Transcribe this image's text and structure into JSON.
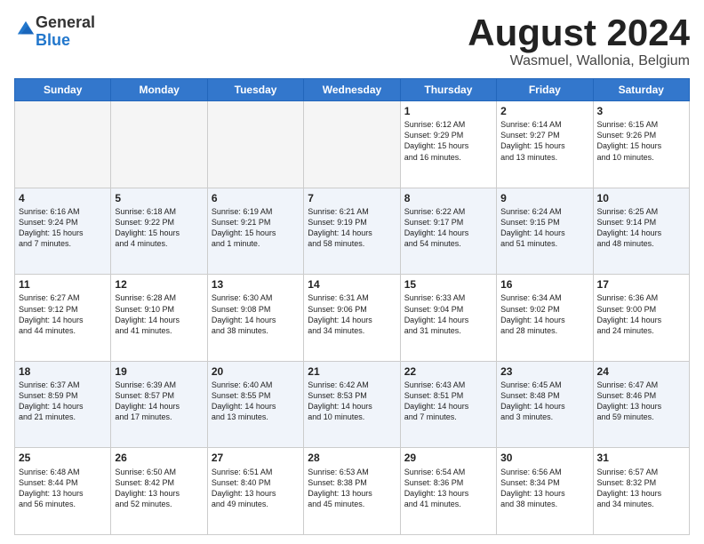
{
  "header": {
    "logo_general": "General",
    "logo_blue": "Blue",
    "title": "August 2024",
    "location": "Wasmuel, Wallonia, Belgium"
  },
  "days_of_week": [
    "Sunday",
    "Monday",
    "Tuesday",
    "Wednesday",
    "Thursday",
    "Friday",
    "Saturday"
  ],
  "weeks": [
    [
      {
        "day": "",
        "info": ""
      },
      {
        "day": "",
        "info": ""
      },
      {
        "day": "",
        "info": ""
      },
      {
        "day": "",
        "info": ""
      },
      {
        "day": "1",
        "info": "Sunrise: 6:12 AM\nSunset: 9:29 PM\nDaylight: 15 hours\nand 16 minutes."
      },
      {
        "day": "2",
        "info": "Sunrise: 6:14 AM\nSunset: 9:27 PM\nDaylight: 15 hours\nand 13 minutes."
      },
      {
        "day": "3",
        "info": "Sunrise: 6:15 AM\nSunset: 9:26 PM\nDaylight: 15 hours\nand 10 minutes."
      }
    ],
    [
      {
        "day": "4",
        "info": "Sunrise: 6:16 AM\nSunset: 9:24 PM\nDaylight: 15 hours\nand 7 minutes."
      },
      {
        "day": "5",
        "info": "Sunrise: 6:18 AM\nSunset: 9:22 PM\nDaylight: 15 hours\nand 4 minutes."
      },
      {
        "day": "6",
        "info": "Sunrise: 6:19 AM\nSunset: 9:21 PM\nDaylight: 15 hours\nand 1 minute."
      },
      {
        "day": "7",
        "info": "Sunrise: 6:21 AM\nSunset: 9:19 PM\nDaylight: 14 hours\nand 58 minutes."
      },
      {
        "day": "8",
        "info": "Sunrise: 6:22 AM\nSunset: 9:17 PM\nDaylight: 14 hours\nand 54 minutes."
      },
      {
        "day": "9",
        "info": "Sunrise: 6:24 AM\nSunset: 9:15 PM\nDaylight: 14 hours\nand 51 minutes."
      },
      {
        "day": "10",
        "info": "Sunrise: 6:25 AM\nSunset: 9:14 PM\nDaylight: 14 hours\nand 48 minutes."
      }
    ],
    [
      {
        "day": "11",
        "info": "Sunrise: 6:27 AM\nSunset: 9:12 PM\nDaylight: 14 hours\nand 44 minutes."
      },
      {
        "day": "12",
        "info": "Sunrise: 6:28 AM\nSunset: 9:10 PM\nDaylight: 14 hours\nand 41 minutes."
      },
      {
        "day": "13",
        "info": "Sunrise: 6:30 AM\nSunset: 9:08 PM\nDaylight: 14 hours\nand 38 minutes."
      },
      {
        "day": "14",
        "info": "Sunrise: 6:31 AM\nSunset: 9:06 PM\nDaylight: 14 hours\nand 34 minutes."
      },
      {
        "day": "15",
        "info": "Sunrise: 6:33 AM\nSunset: 9:04 PM\nDaylight: 14 hours\nand 31 minutes."
      },
      {
        "day": "16",
        "info": "Sunrise: 6:34 AM\nSunset: 9:02 PM\nDaylight: 14 hours\nand 28 minutes."
      },
      {
        "day": "17",
        "info": "Sunrise: 6:36 AM\nSunset: 9:00 PM\nDaylight: 14 hours\nand 24 minutes."
      }
    ],
    [
      {
        "day": "18",
        "info": "Sunrise: 6:37 AM\nSunset: 8:59 PM\nDaylight: 14 hours\nand 21 minutes."
      },
      {
        "day": "19",
        "info": "Sunrise: 6:39 AM\nSunset: 8:57 PM\nDaylight: 14 hours\nand 17 minutes."
      },
      {
        "day": "20",
        "info": "Sunrise: 6:40 AM\nSunset: 8:55 PM\nDaylight: 14 hours\nand 13 minutes."
      },
      {
        "day": "21",
        "info": "Sunrise: 6:42 AM\nSunset: 8:53 PM\nDaylight: 14 hours\nand 10 minutes."
      },
      {
        "day": "22",
        "info": "Sunrise: 6:43 AM\nSunset: 8:51 PM\nDaylight: 14 hours\nand 7 minutes."
      },
      {
        "day": "23",
        "info": "Sunrise: 6:45 AM\nSunset: 8:48 PM\nDaylight: 14 hours\nand 3 minutes."
      },
      {
        "day": "24",
        "info": "Sunrise: 6:47 AM\nSunset: 8:46 PM\nDaylight: 13 hours\nand 59 minutes."
      }
    ],
    [
      {
        "day": "25",
        "info": "Sunrise: 6:48 AM\nSunset: 8:44 PM\nDaylight: 13 hours\nand 56 minutes."
      },
      {
        "day": "26",
        "info": "Sunrise: 6:50 AM\nSunset: 8:42 PM\nDaylight: 13 hours\nand 52 minutes."
      },
      {
        "day": "27",
        "info": "Sunrise: 6:51 AM\nSunset: 8:40 PM\nDaylight: 13 hours\nand 49 minutes."
      },
      {
        "day": "28",
        "info": "Sunrise: 6:53 AM\nSunset: 8:38 PM\nDaylight: 13 hours\nand 45 minutes."
      },
      {
        "day": "29",
        "info": "Sunrise: 6:54 AM\nSunset: 8:36 PM\nDaylight: 13 hours\nand 41 minutes."
      },
      {
        "day": "30",
        "info": "Sunrise: 6:56 AM\nSunset: 8:34 PM\nDaylight: 13 hours\nand 38 minutes."
      },
      {
        "day": "31",
        "info": "Sunrise: 6:57 AM\nSunset: 8:32 PM\nDaylight: 13 hours\nand 34 minutes."
      }
    ]
  ]
}
